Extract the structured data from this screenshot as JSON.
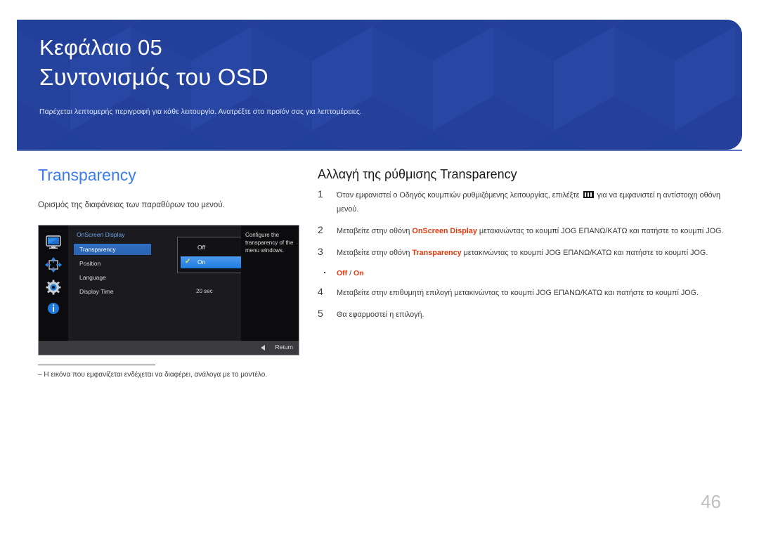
{
  "banner": {
    "chapter_label": "Κεφάλαιο 05",
    "chapter_title": "Συντονισμός του OSD",
    "subtitle": "Παρέχεται λεπτομερής περιγραφή για κάθε λειτουργία. Ανατρέξτε στο προϊόν σας για λεπτομέρειες.",
    "bg_color": "#24409a",
    "title_color": "#ffffff"
  },
  "left": {
    "section_heading": "Transparency",
    "section_heading_color": "#3a7cf0",
    "description": "Ορισμός της διαφάνειας των παραθύρων του μενού.",
    "footnote": "‒  Η εικόνα που εμφανίζεται ενδέχεται να διαφέρει, ανάλογα με το μοντέλο."
  },
  "osd": {
    "icons": [
      {
        "name": "monitor-icon",
        "label": "Picture"
      },
      {
        "name": "position-arrows-icon",
        "label": "Position"
      },
      {
        "name": "gear-icon",
        "label": "System"
      },
      {
        "name": "info-icon",
        "label": "Information"
      }
    ],
    "menu_title": "OnScreen Display",
    "rows": [
      {
        "label": "Transparency",
        "value": "",
        "selected": true
      },
      {
        "label": "Position",
        "value": "",
        "selected": false
      },
      {
        "label": "Language",
        "value": "",
        "selected": false
      },
      {
        "label": "Display Time",
        "value": "20 sec",
        "selected": false
      }
    ],
    "dropdown": {
      "options": [
        {
          "label": "Off",
          "checked": false
        },
        {
          "label": "On",
          "checked": true
        }
      ],
      "check_glyph": "✓",
      "highlight_color": "#2f8ae8"
    },
    "help_text": "Configure the transparency of the menu windows.",
    "return_label": "Return"
  },
  "steps": {
    "heading": "Αλλαγή της ρύθμισης Transparency",
    "items": [
      {
        "num": "1",
        "pre": "Όταν εμφανιστεί ο Οδηγός κουμπιών ρυθμιζόμενης λειτουργίας, επιλέξτε ",
        "glyph": "menu-glyph",
        "post": " για να εμφανιστεί η αντίστοιχη οθόνη μενού."
      },
      {
        "num": "2",
        "pre": "Μεταβείτε στην οθόνη ",
        "highlight": "OnScreen Display",
        "post": " μετακινώντας το κουμπί JOG ΕΠΑΝΩ/ΚΑΤΩ και πατήστε το κουμπί JOG."
      },
      {
        "num": "3",
        "pre": "Μεταβείτε στην οθόνη ",
        "highlight": "Transparency",
        "post": " μετακινώντας το κουμπί JOG ΕΠΑΝΩ/ΚΑΤΩ και πατήστε το κουμπί JOG."
      }
    ],
    "bullet": {
      "option_a": "Off",
      "separator": " / ",
      "option_b": "On"
    },
    "items_after": [
      {
        "num": "4",
        "pre": "Μεταβείτε στην επιθυμητή επιλογή μετακινώντας το κουμπί JOG ΕΠΑΝΩ/ΚΑΤΩ και πατήστε το κουμπί JOG.",
        "post": ""
      },
      {
        "num": "5",
        "pre": "Θα εφαρμοστεί η επιλογή.",
        "post": ""
      }
    ],
    "highlight_color": "#e8380d"
  },
  "page_number": "46"
}
